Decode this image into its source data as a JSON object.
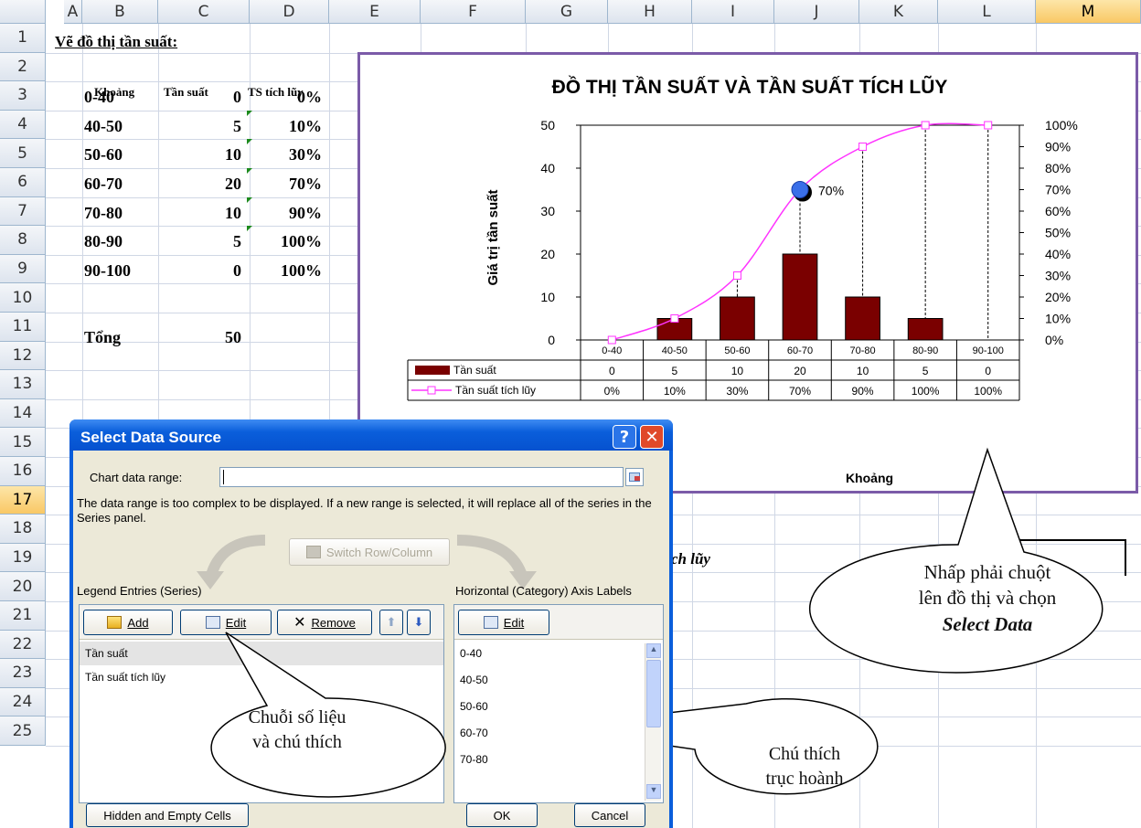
{
  "columns": [
    "A",
    "B",
    "C",
    "D",
    "E",
    "F",
    "G",
    "H",
    "I",
    "J",
    "K",
    "L",
    "M"
  ],
  "rows": [
    "1",
    "2",
    "3",
    "4",
    "5",
    "6",
    "7",
    "8",
    "9",
    "10",
    "11",
    "12",
    "13",
    "14",
    "15",
    "16",
    "17",
    "18",
    "19",
    "20",
    "21",
    "22",
    "23",
    "24",
    "25"
  ],
  "selected_column": "M",
  "selected_row": "17",
  "sheet": {
    "title": "Vẽ đồ thị tần suất:",
    "headers": {
      "khoang": "Khoảng",
      "tan_suat": "Tần suất",
      "ts_tich_luy": "TS tích lũy"
    },
    "table": [
      {
        "khoang": "0-40",
        "tan_suat": "0",
        "tich_luy": "0%"
      },
      {
        "khoang": "40-50",
        "tan_suat": "5",
        "tich_luy": "10%"
      },
      {
        "khoang": "50-60",
        "tan_suat": "10",
        "tich_luy": "30%"
      },
      {
        "khoang": "60-70",
        "tan_suat": "20",
        "tich_luy": "70%"
      },
      {
        "khoang": "70-80",
        "tan_suat": "10",
        "tich_luy": "90%"
      },
      {
        "khoang": "80-90",
        "tan_suat": "5",
        "tich_luy": "100%"
      },
      {
        "khoang": "90-100",
        "tan_suat": "0",
        "tich_luy": "100%"
      }
    ],
    "total_label": "Tổng",
    "total_value": "50",
    "partial_text": "ch lũy"
  },
  "chart_data": {
    "type": "bar",
    "title": "ĐỒ THỊ TẦN SUẤT VÀ TẦN SUẤT TÍCH LŨY",
    "xlabel": "Khoảng",
    "ylabel": "Giá trị tần suất",
    "categories": [
      "0-40",
      "40-50",
      "50-60",
      "60-70",
      "70-80",
      "80-90",
      "90-100"
    ],
    "ylim": [
      0,
      50
    ],
    "y_ticks": [
      "0",
      "10",
      "20",
      "30",
      "40",
      "50"
    ],
    "y2lim": [
      0,
      100
    ],
    "y2_ticks": [
      "0%",
      "10%",
      "20%",
      "30%",
      "40%",
      "50%",
      "60%",
      "70%",
      "80%",
      "90%",
      "100%"
    ],
    "series": [
      {
        "name": "Tần suất",
        "type": "bar",
        "values": [
          0,
          5,
          10,
          20,
          10,
          5,
          0
        ],
        "color": "#7a0000",
        "labels": [
          "0",
          "5",
          "10",
          "20",
          "10",
          "5",
          "0"
        ]
      },
      {
        "name": "Tần suất tích lũy",
        "type": "line",
        "axis": "secondary",
        "values": [
          0,
          10,
          30,
          70,
          90,
          100,
          100
        ],
        "color": "#ff33ff",
        "labels": [
          "0%",
          "10%",
          "30%",
          "70%",
          "90%",
          "100%",
          "100%"
        ]
      }
    ],
    "annotation": "70%",
    "grid": false,
    "legend": "data-table"
  },
  "dialog": {
    "title": "Select Data Source",
    "help_btn": "?",
    "close_btn": "✕",
    "chart_range_label": "Chart data range:",
    "chart_range_value": "",
    "message": "The data range is too complex to be displayed. If a new range is selected, it will replace all of the series in the Series panel.",
    "switch_btn": "Switch Row/Column",
    "legend_header": "Legend Entries (Series)",
    "add_btn": "Add",
    "edit_btn": "Edit",
    "remove_btn": "Remove",
    "series_items": [
      "Tần suất",
      "Tần suất tích lũy"
    ],
    "axis_header": "Horizontal (Category) Axis Labels",
    "axis_edit_btn": "Edit",
    "axis_items": [
      "0-40",
      "40-50",
      "50-60",
      "60-70",
      "70-80"
    ],
    "hidden_btn": "Hidden and Empty Cells",
    "ok_btn": "OK",
    "cancel_btn": "Cancel"
  },
  "callouts": {
    "series_line1": "Chuỗi số liệu",
    "series_line2": "và chú thích",
    "axis_line1": "Chú thích",
    "axis_line2": "trục hoành",
    "right_line1": "Nhấp phải chuột",
    "right_line2": "lên đồ thị và chọn",
    "right_line3": "Select Data"
  }
}
